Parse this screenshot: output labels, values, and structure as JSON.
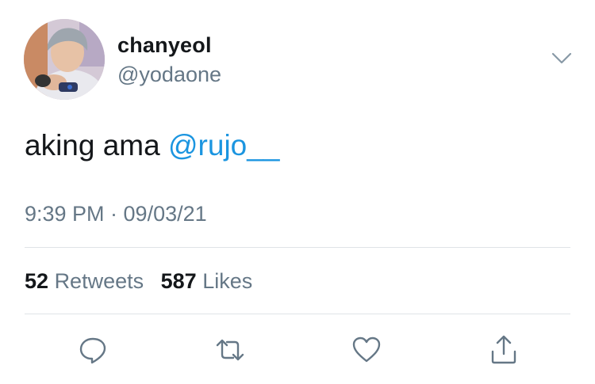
{
  "author": {
    "display_name": "chanyeol",
    "handle": "@yodaone"
  },
  "tweet": {
    "text": "aking ama ",
    "mention": "@rujo__"
  },
  "meta": {
    "timestamp": "9:39 PM · 09/03/21"
  },
  "stats": {
    "retweets_count": "52",
    "retweets_label": "Retweets",
    "likes_count": "587",
    "likes_label": "Likes"
  },
  "icons": {
    "menu": "chevron-down-icon",
    "reply": "reply-icon",
    "retweet": "retweet-icon",
    "like": "heart-icon",
    "share": "share-icon"
  },
  "colors": {
    "text": "#14171a",
    "secondary": "#657786",
    "link": "#1b95e0",
    "divider": "#dfe3e7"
  }
}
